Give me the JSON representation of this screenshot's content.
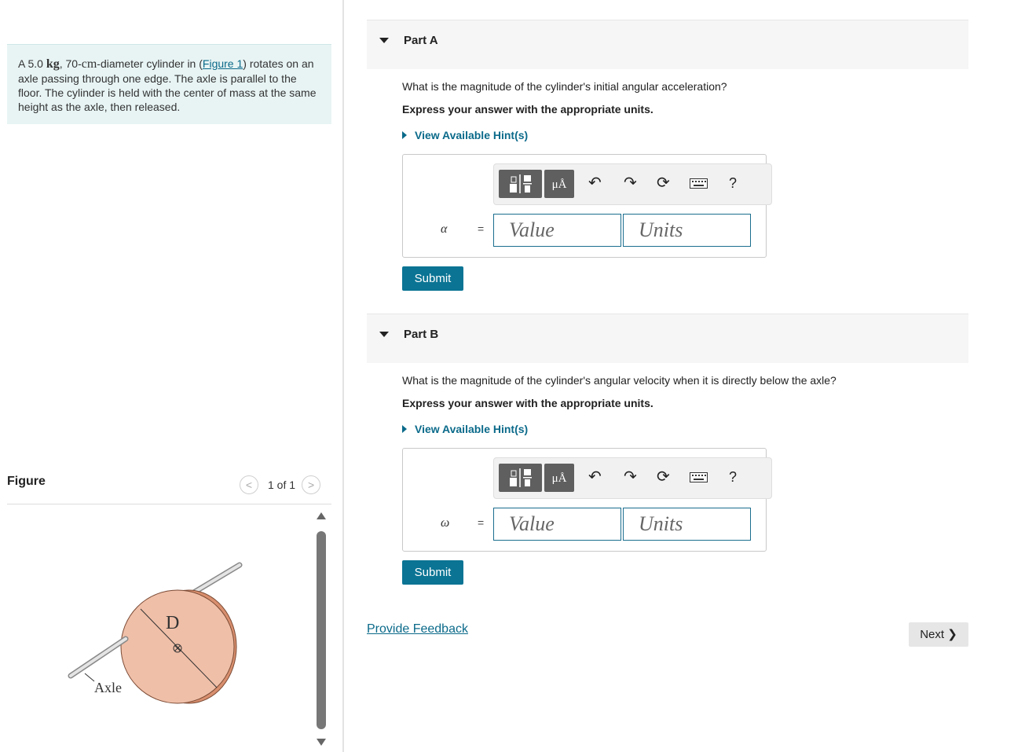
{
  "problem": {
    "prefix": "A ",
    "mass_value": "5.0",
    "mass_unit": "kg",
    "mid": ", 70-",
    "cm_unit": "cm",
    "after_cm": "-diameter cylinder in (",
    "figure_link": "Figure 1",
    "rest": ") rotates on an axle passing through one edge. The axle is parallel to the floor. The cylinder is held with the center of mass at the same height as the axle, then released."
  },
  "figure": {
    "title": "Figure",
    "prev": "<",
    "next": ">",
    "counter": "1 of 1",
    "label_d": "D",
    "label_axle": "Axle"
  },
  "parts": [
    {
      "title": "Part A",
      "question": "What is the magnitude of the cylinder's initial angular acceleration?",
      "express": "Express your answer with the appropriate units.",
      "hint": "View Available Hint(s)",
      "symbol": "α",
      "equals": "=",
      "value_placeholder": "Value",
      "units_placeholder": "Units",
      "submit": "Submit"
    },
    {
      "title": "Part B",
      "question": "What is the magnitude of the cylinder's angular velocity when it is directly below the axle?",
      "express": "Express your answer with the appropriate units.",
      "hint": "View Available Hint(s)",
      "symbol": "ω",
      "equals": "=",
      "value_placeholder": "Value",
      "units_placeholder": "Units",
      "submit": "Submit"
    }
  ],
  "toolbar": {
    "mu_label": "μÅ",
    "help": "?"
  },
  "footer": {
    "feedback": "Provide Feedback",
    "next": "Next"
  },
  "colors": {
    "accent": "#0b7494",
    "link": "#0b6a8a",
    "problem_bg": "#e8f4f4",
    "cylinder_face": "#f0bfa8",
    "cylinder_rim": "#d88f6e"
  }
}
